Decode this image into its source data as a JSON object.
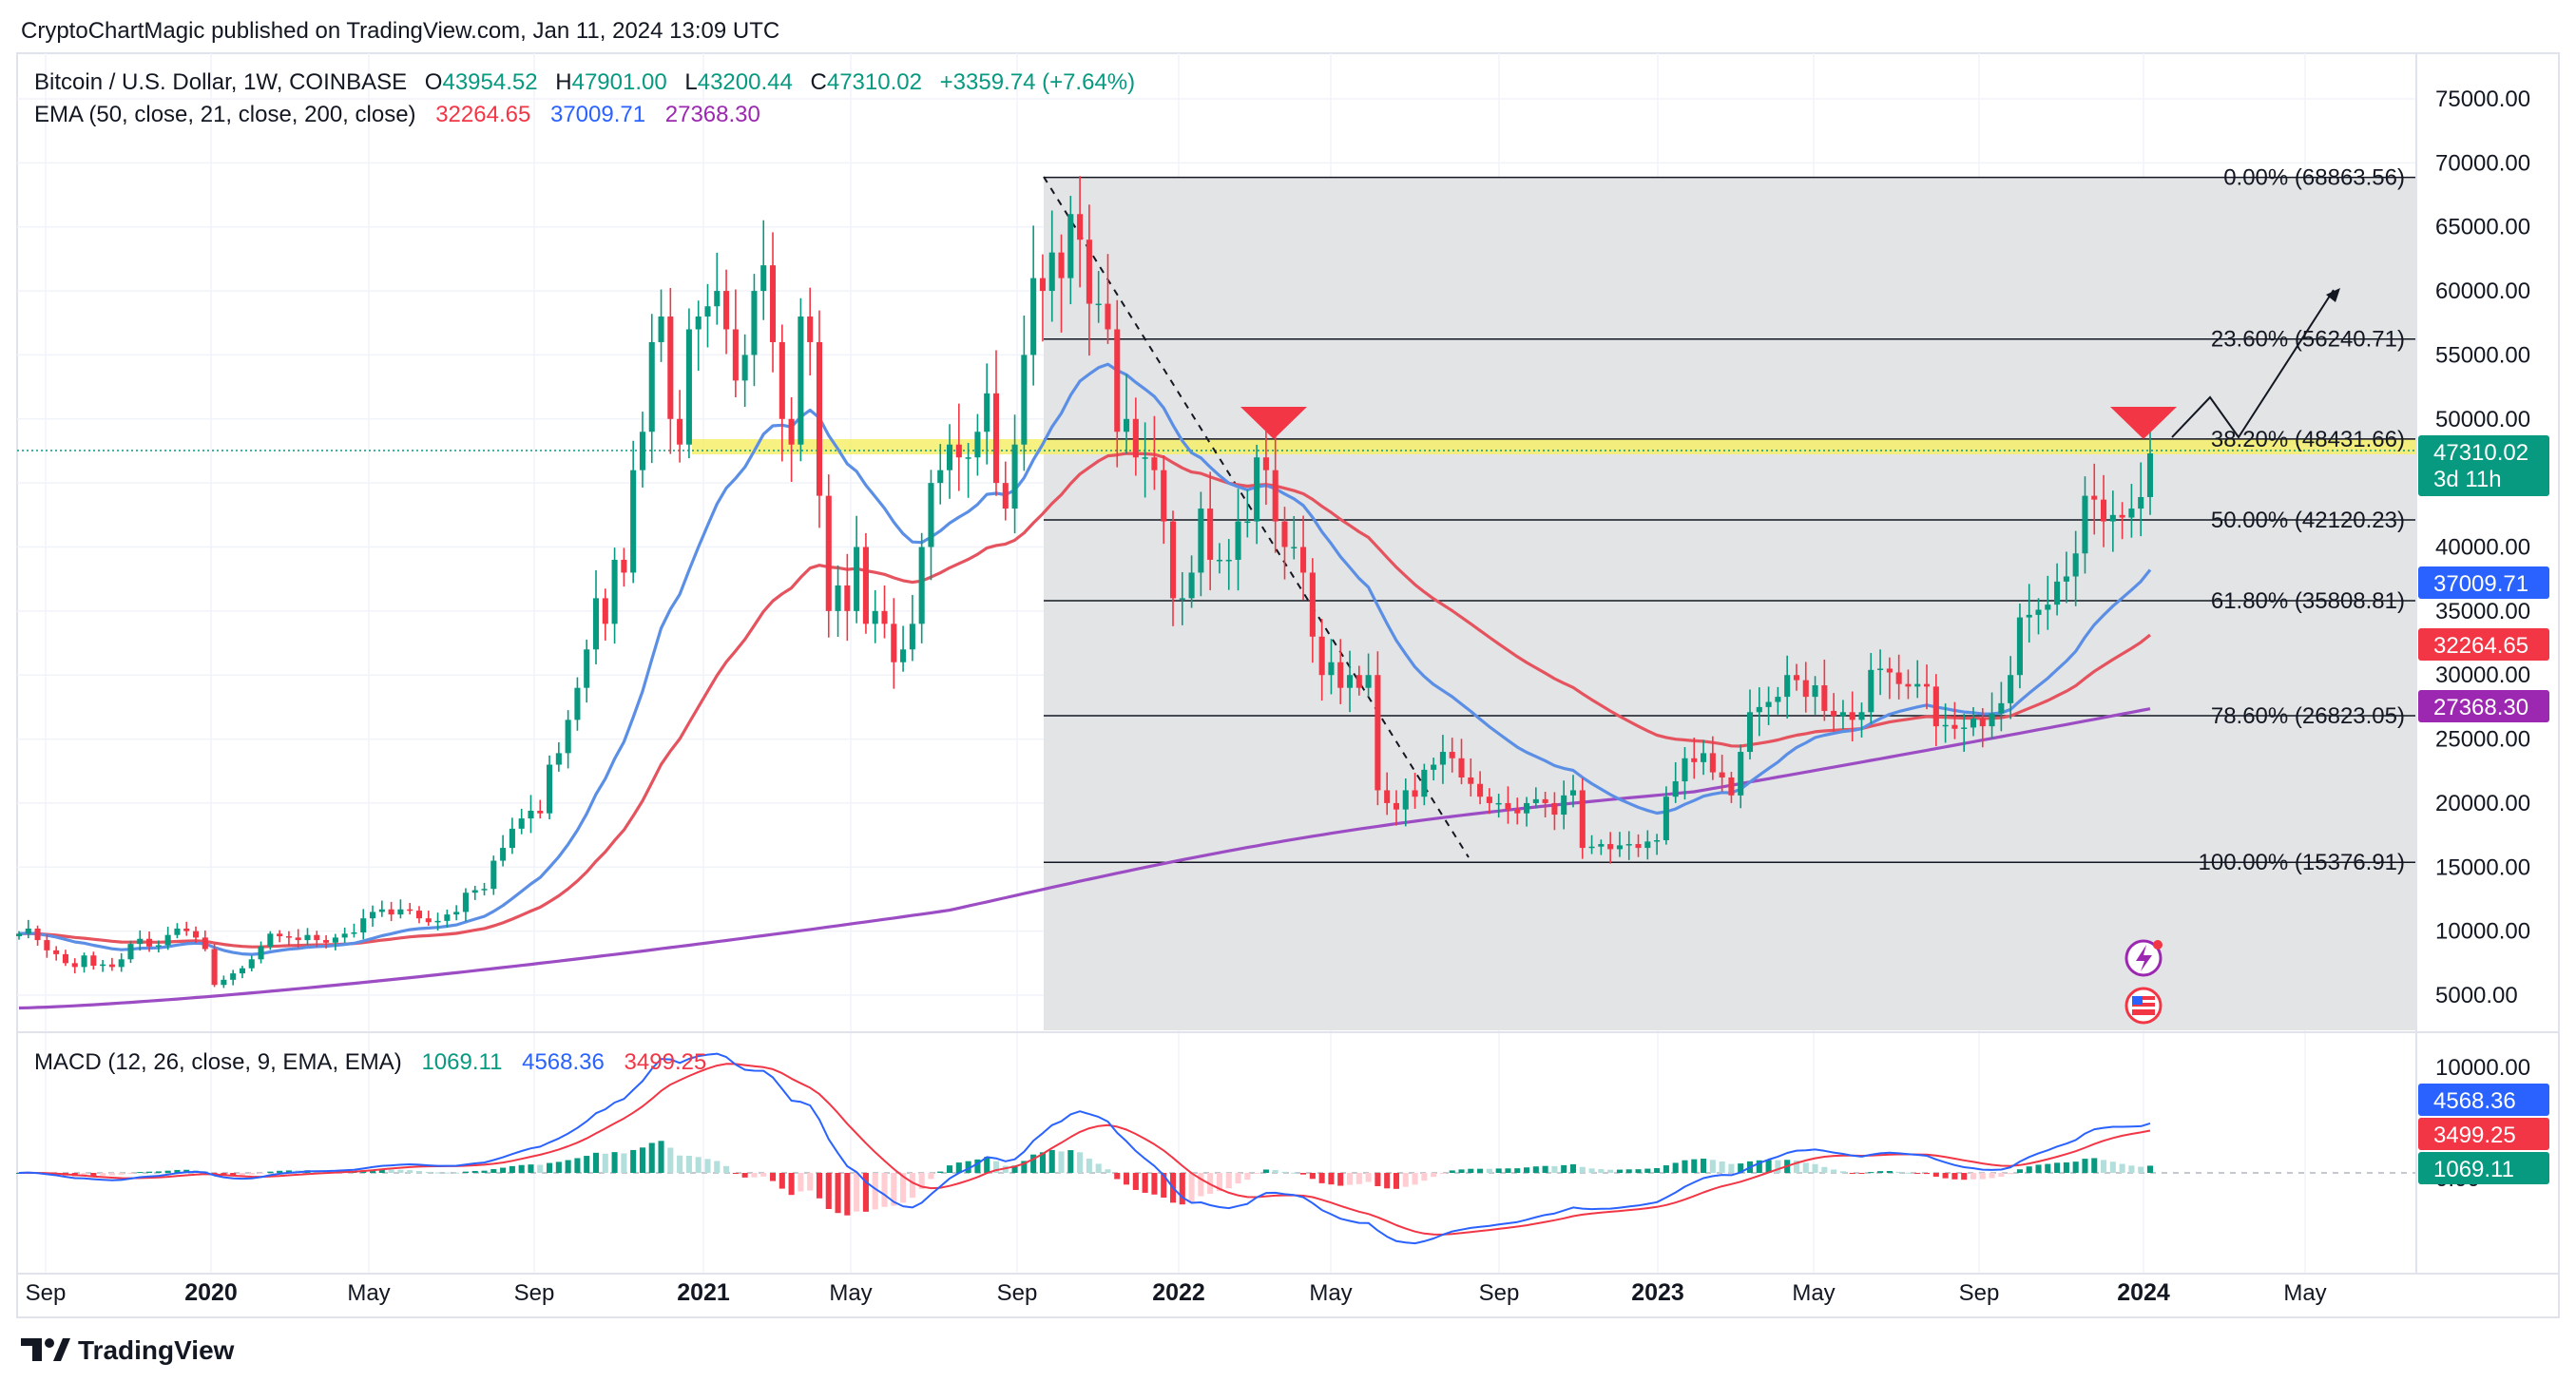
{
  "header": {
    "published_text": "CryptoChartMagic published on TradingView.com, Jan 11, 2024 13:09 UTC",
    "symbol_text": "Bitcoin / U.S. Dollar, 1W, COINBASE",
    "ohlc": [
      {
        "key": "O",
        "value": "43954.52"
      },
      {
        "key": "H",
        "value": "47901.00"
      },
      {
        "key": "L",
        "value": "43200.44"
      },
      {
        "key": "C",
        "value": "47310.02"
      }
    ],
    "change": "+3359.74 (+7.64%)",
    "ema_title": "EMA (50, close, 21, close, 200, close)",
    "ema_values": [
      "32264.65",
      "37009.71",
      "27368.30"
    ],
    "macd_title": "MACD (12, 26, close, 9, EMA, EMA)",
    "macd_values": [
      "1069.11",
      "4568.36",
      "3499.25"
    ]
  },
  "footer": {
    "brand": "TradingView"
  },
  "colors": {
    "up": "#089981",
    "down": "#f23645",
    "ema50": "#e5535f",
    "ema21": "#5b8fe6",
    "ema200": "#9c4dc4",
    "macd": "#2962ff",
    "signal": "#f23645",
    "fib_zone": "#e3e4e5",
    "resistance": "#f5ef6a"
  },
  "chart_data": [
    {
      "type": "candlestick",
      "title": "Bitcoin / U.S. Dollar, 1W, COINBASE",
      "y_axis_ticks": [
        "75000.00",
        "70000.00",
        "65000.00",
        "60000.00",
        "55000.00",
        "50000.00",
        "45000.00",
        "40000.00",
        "35000.00",
        "30000.00",
        "25000.00",
        "20000.00",
        "15000.00",
        "10000.00",
        "5000.00"
      ],
      "x_axis_ticks": [
        {
          "label": "Sep",
          "bold": false
        },
        {
          "label": "2020",
          "bold": true
        },
        {
          "label": "May",
          "bold": false
        },
        {
          "label": "Sep",
          "bold": false
        },
        {
          "label": "2021",
          "bold": true
        },
        {
          "label": "May",
          "bold": false
        },
        {
          "label": "Sep",
          "bold": false
        },
        {
          "label": "2022",
          "bold": true
        },
        {
          "label": "May",
          "bold": false
        },
        {
          "label": "Sep",
          "bold": false
        },
        {
          "label": "2023",
          "bold": true
        },
        {
          "label": "May",
          "bold": false
        },
        {
          "label": "Sep",
          "bold": false
        },
        {
          "label": "2024",
          "bold": true
        },
        {
          "label": "May",
          "bold": false
        }
      ],
      "weekly_closes": [
        9800,
        10200,
        9300,
        8500,
        8200,
        7500,
        7200,
        8100,
        7300,
        7400,
        7200,
        7800,
        9000,
        9400,
        8800,
        8900,
        9700,
        10200,
        10000,
        9500,
        8600,
        5800,
        6200,
        6700,
        7100,
        7800,
        8800,
        9800,
        9600,
        9500,
        9300,
        9700,
        9300,
        9100,
        9500,
        9800,
        9900,
        11000,
        11500,
        11700,
        11300,
        11700,
        11600,
        11000,
        10700,
        10800,
        11300,
        11500,
        13000,
        13200,
        13300,
        15500,
        16500,
        18000,
        18800,
        19400,
        19200,
        23000,
        23900,
        26500,
        29000,
        32000,
        36000,
        34000,
        39000,
        38000,
        46000,
        49000,
        56000,
        58000,
        50000,
        48000,
        57000,
        58000,
        58800,
        60000,
        57000,
        53000,
        55000,
        60000,
        62000,
        56000,
        50000,
        48000,
        58000,
        56000,
        44000,
        35000,
        37000,
        35000,
        40000,
        34000,
        35000,
        34000,
        31000,
        32000,
        34000,
        40000,
        45000,
        46000,
        48000,
        47000,
        47000,
        49000,
        52000,
        45000,
        43000,
        48000,
        55000,
        61000,
        60000,
        63000,
        61000,
        66000,
        64000,
        59000,
        59000,
        57000,
        49000,
        50000,
        47000,
        47000,
        46000,
        42000,
        36000,
        36000,
        38000,
        43000,
        39000,
        39000,
        39000,
        42000,
        42000,
        47000,
        46000,
        42000,
        40000,
        40000,
        38000,
        33000,
        30000,
        31000,
        29000,
        30000,
        29000,
        30000,
        21000,
        20000,
        19500,
        21000,
        20500,
        22600,
        23000,
        24000,
        23500,
        22000,
        21500,
        20500,
        20000,
        20000,
        19500,
        19200,
        20000,
        20300,
        20000,
        19100,
        20600,
        21000,
        16500,
        16600,
        16800,
        16400,
        16700,
        16800,
        16500,
        17000,
        17100,
        20500,
        21700,
        23500,
        23200,
        23900,
        22400,
        22000,
        20600,
        24000,
        27100,
        27500,
        27900,
        28300,
        30000,
        29600,
        28300,
        29200,
        27200,
        26800,
        27100,
        26500,
        27100,
        30400,
        30500,
        30200,
        29300,
        29100,
        29300,
        29100,
        26000,
        26100,
        25800,
        25900,
        26600,
        26000,
        27000,
        27800,
        30000,
        34500,
        34700,
        35100,
        35500,
        37300,
        37700,
        39500,
        44000,
        43700,
        42000,
        42500,
        42300,
        43000,
        43900,
        47310
      ],
      "ema_series": [
        {
          "name": "EMA 50",
          "last_value": 32264.65
        },
        {
          "name": "EMA 21",
          "last_value": 37009.71
        },
        {
          "name": "EMA 200",
          "last_value": 27368.3
        }
      ],
      "last_price": {
        "value": "47310.02",
        "countdown": "3d 11h"
      },
      "fibonacci_retracement": [
        {
          "level": "0.00%",
          "price": 68863.56
        },
        {
          "level": "23.60%",
          "price": 56240.71
        },
        {
          "level": "38.20%",
          "price": 48431.66
        },
        {
          "level": "50.00%",
          "price": 42120.23
        },
        {
          "level": "61.80%",
          "price": 35808.81
        },
        {
          "level": "78.60%",
          "price": 26823.05
        },
        {
          "level": "100.00%",
          "price": 15376.91
        }
      ],
      "annotations": [
        "resistance zone near 48000",
        "two red triangle markers at resistance",
        "dashed trend line from 2021 high to 2022 low",
        "projected path arrow toward 60000"
      ]
    },
    {
      "type": "line",
      "title": "MACD (12, 26, close, 9, EMA, EMA)",
      "y_axis_ticks": [
        "10000.00",
        "0.00"
      ],
      "series": [
        {
          "name": "MACD",
          "last_value": 4568.36
        },
        {
          "name": "Signal",
          "last_value": 3499.25
        },
        {
          "name": "Histogram",
          "last_value": 1069.11
        }
      ]
    }
  ]
}
